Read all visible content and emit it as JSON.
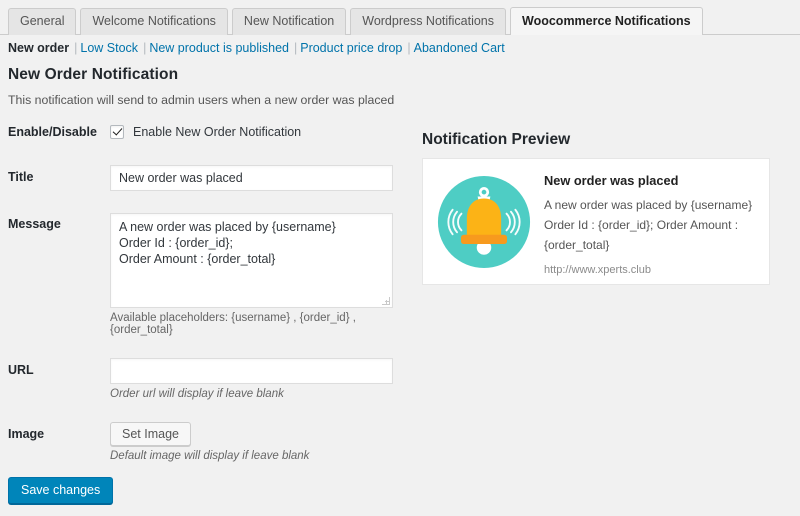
{
  "tabs": [
    {
      "label": "General",
      "active": false
    },
    {
      "label": "Welcome Notifications",
      "active": false
    },
    {
      "label": "New Notification",
      "active": false
    },
    {
      "label": "Wordpress Notifications",
      "active": false
    },
    {
      "label": "Woocommerce Notifications",
      "active": true
    }
  ],
  "subnav": {
    "current": "New order",
    "links": [
      "Low Stock",
      "New product is published",
      "Product price drop",
      "Abandoned Cart"
    ],
    "separator": "|"
  },
  "page": {
    "title": "New Order Notification",
    "description": "This notification will send to admin users when a new order was placed"
  },
  "form": {
    "enable": {
      "label": "Enable/Disable",
      "checkbox_label": "Enable New Order Notification",
      "checked": true
    },
    "title": {
      "label": "Title",
      "value": "New order was placed",
      "placeholder": ""
    },
    "message": {
      "label": "Message",
      "value": "A new order was placed by {username}\nOrder Id : {order_id};\nOrder Amount : {order_total}",
      "placeholder": "",
      "hint": "Available placeholders: {username} , {order_id} , {order_total}"
    },
    "url": {
      "label": "URL",
      "value": "",
      "placeholder": "",
      "hint": "Order url will display if leave blank"
    },
    "image": {
      "label": "Image",
      "button_label": "Set Image",
      "hint": "Default image will display if leave blank"
    },
    "save_label": "Save changes"
  },
  "preview": {
    "title": "Notification Preview",
    "heading": "New order was placed",
    "body": "A new order was placed by {username} Order Id : {order_id}; Order Amount : {order_total}",
    "url": "http://www.xperts.club",
    "icon": "bell-icon"
  },
  "colors": {
    "accent": "#0085ba",
    "link": "#0073aa",
    "page_bg": "#f1f1f1",
    "bell_circle": "#4ecdc4",
    "bell_body": "#fcb316",
    "bell_base": "#f79a1e"
  }
}
